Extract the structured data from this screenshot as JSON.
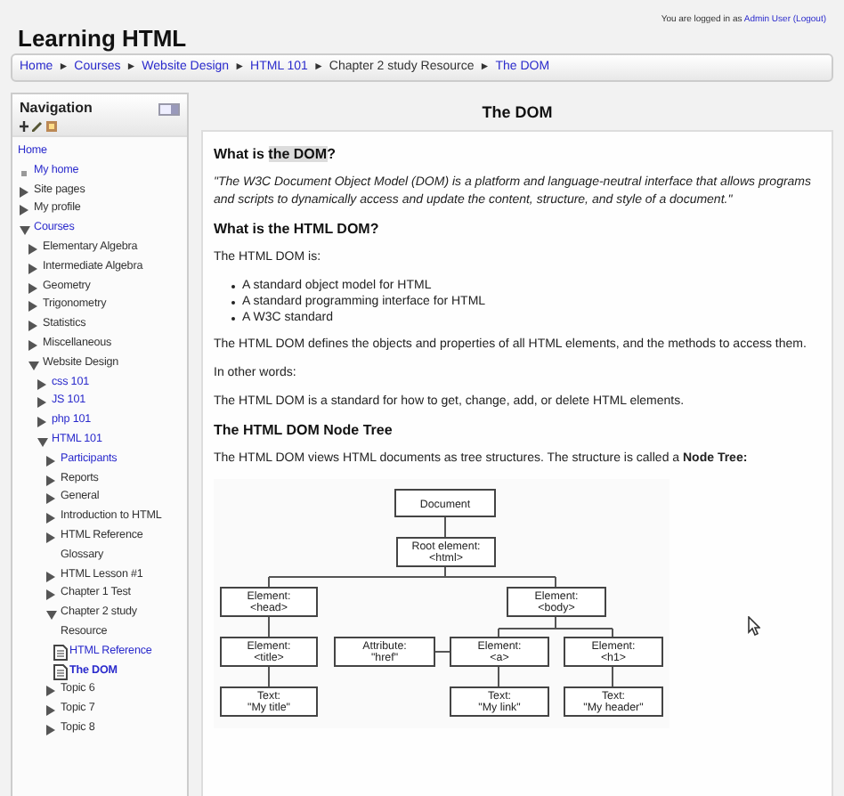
{
  "site_title": "Learning HTML",
  "login": {
    "prefix": "You are logged in as",
    "user": "Admin User",
    "logout": "(Logout)"
  },
  "breadcrumb": [
    {
      "label": "Home",
      "link": true
    },
    {
      "label": "Courses",
      "link": true,
      "sep": "►"
    },
    {
      "label": "Website Design",
      "link": true,
      "sep": "►"
    },
    {
      "label": "HTML 101",
      "link": true,
      "sep": "►"
    },
    {
      "label": "Chapter 2 study Resource",
      "link": false,
      "sep": "►"
    },
    {
      "label": "The DOM",
      "link": true,
      "sep": "►"
    }
  ],
  "navigation": {
    "title": "Navigation",
    "items": [
      {
        "label": "Home",
        "link": true,
        "selected": false,
        "kind": "none",
        "children": [
          {
            "label": "My home",
            "link": true,
            "selected": false,
            "kind": "bullet"
          },
          {
            "label": "Site pages",
            "link": false,
            "selected": false,
            "kind": "collapsed"
          },
          {
            "label": "My profile",
            "link": false,
            "selected": false,
            "kind": "collapsed"
          },
          {
            "label": "Courses",
            "link": true,
            "selected": false,
            "kind": "expanded",
            "children": [
              {
                "label": "Elementary Algebra",
                "link": false,
                "selected": false,
                "kind": "collapsed"
              },
              {
                "label": "Intermediate Algebra",
                "link": false,
                "selected": false,
                "kind": "collapsed"
              },
              {
                "label": "Geometry",
                "link": false,
                "selected": false,
                "kind": "collapsed"
              },
              {
                "label": "Trigonometry",
                "link": false,
                "selected": false,
                "kind": "collapsed"
              },
              {
                "label": "Statistics",
                "link": false,
                "selected": false,
                "kind": "collapsed"
              },
              {
                "label": "Miscellaneous",
                "link": false,
                "selected": false,
                "kind": "collapsed"
              },
              {
                "label": "Website Design",
                "link": false,
                "selected": false,
                "kind": "expanded",
                "children": [
                  {
                    "label": "css 101",
                    "link": true,
                    "selected": false,
                    "kind": "collapsed"
                  },
                  {
                    "label": "JS 101",
                    "link": true,
                    "selected": false,
                    "kind": "collapsed"
                  },
                  {
                    "label": "php 101",
                    "link": true,
                    "selected": false,
                    "kind": "collapsed"
                  },
                  {
                    "label": "HTML 101",
                    "link": true,
                    "selected": false,
                    "kind": "expanded",
                    "children": [
                      {
                        "label": "Participants",
                        "link": true,
                        "selected": false,
                        "kind": "collapsed"
                      },
                      {
                        "label": "Reports",
                        "link": false,
                        "selected": false,
                        "kind": "collapsed"
                      },
                      {
                        "label": "General",
                        "link": false,
                        "selected": false,
                        "kind": "collapsed"
                      },
                      {
                        "label": "Introduction to HTML",
                        "link": false,
                        "selected": false,
                        "kind": "collapsed"
                      },
                      {
                        "label": "HTML Reference Glossary",
                        "link": false,
                        "selected": false,
                        "kind": "collapsed"
                      },
                      {
                        "label": "HTML Lesson #1",
                        "link": false,
                        "selected": false,
                        "kind": "collapsed"
                      },
                      {
                        "label": "Chapter 1 Test",
                        "link": false,
                        "selected": false,
                        "kind": "collapsed"
                      },
                      {
                        "label": "Chapter 2 study Resource",
                        "link": false,
                        "selected": false,
                        "kind": "expanded",
                        "children": [
                          {
                            "label": "HTML Reference",
                            "link": true,
                            "selected": false,
                            "kind": "page"
                          },
                          {
                            "label": "The DOM",
                            "link": true,
                            "selected": true,
                            "kind": "page"
                          }
                        ]
                      },
                      {
                        "label": "Topic 6",
                        "link": false,
                        "selected": false,
                        "kind": "collapsed"
                      },
                      {
                        "label": "Topic 7",
                        "link": false,
                        "selected": false,
                        "kind": "collapsed"
                      },
                      {
                        "label": "Topic 8",
                        "link": false,
                        "selected": false,
                        "kind": "collapsed"
                      }
                    ]
                  }
                ]
              }
            ]
          }
        ]
      }
    ]
  },
  "page_title": "The DOM",
  "content": [
    {
      "kind": "heading",
      "parts": [
        {
          "text": "What is ",
          "highlight": false
        },
        {
          "text": "the DOM",
          "highlight": true
        },
        {
          "text": "?",
          "highlight": false
        }
      ]
    },
    {
      "kind": "quote",
      "text": "\"The W3C Document Object Model (DOM) is a platform and language-neutral interface that allows programs and scripts to dynamically access and update the content, structure, and style of a document.\""
    },
    {
      "kind": "heading",
      "parts": [
        {
          "text": "What is the HTML DOM?",
          "highlight": false
        }
      ]
    },
    {
      "kind": "paragraph",
      "text": "The HTML DOM is:"
    },
    {
      "kind": "list",
      "items": [
        "A standard object model for HTML",
        "A standard programming interface for HTML",
        "A W3C standard"
      ]
    },
    {
      "kind": "paragraph",
      "text": "The HTML DOM defines the objects and properties of all HTML elements, and the methods to access them."
    },
    {
      "kind": "paragraph",
      "text": "In other words:"
    },
    {
      "kind": "paragraph",
      "text": "The HTML DOM is a standard for how to get, change, add, or delete HTML elements."
    },
    {
      "kind": "heading",
      "parts": [
        {
          "text": "The HTML DOM Node Tree",
          "highlight": false
        }
      ]
    },
    {
      "kind": "paragraph",
      "text": "The HTML DOM views HTML documents as tree structures. The structure is called a **Node Tree:**"
    },
    {
      "kind": "diagram",
      "nodes": [
        {
          "lines": [
            "Document"
          ]
        },
        {
          "lines": [
            "Root element:",
            "<html>"
          ]
        },
        {
          "lines": [
            "Element:",
            "<head>"
          ]
        },
        {
          "lines": [
            "Element:",
            "<body>"
          ]
        },
        {
          "lines": [
            "Element:",
            "<title>"
          ]
        },
        {
          "lines": [
            "Attribute:",
            "\"href\""
          ]
        },
        {
          "lines": [
            "Element:",
            "<a>"
          ]
        },
        {
          "lines": [
            "Element:",
            "<h1>"
          ]
        },
        {
          "lines": [
            "Text:",
            "\"My title\""
          ]
        },
        {
          "lines": [
            "Text:",
            "\"My link\""
          ]
        },
        {
          "lines": [
            "Text:",
            "\"My header\""
          ]
        }
      ]
    }
  ]
}
